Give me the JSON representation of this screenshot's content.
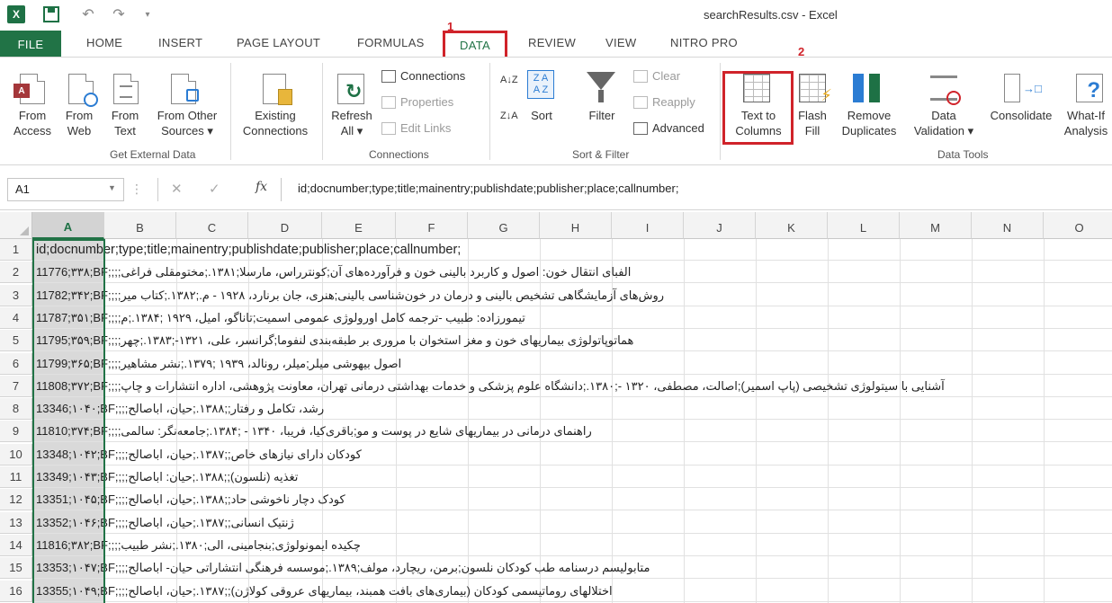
{
  "window": {
    "title": "searchResults.csv - Excel",
    "app_badge": "X"
  },
  "tabs": [
    "FILE",
    "HOME",
    "INSERT",
    "PAGE LAYOUT",
    "FORMULAS",
    "DATA",
    "REVIEW",
    "VIEW",
    "NITRO PRO"
  ],
  "annotations": {
    "step1": "1",
    "step2": "2"
  },
  "ribbon": {
    "get_external": {
      "label": "Get External Data",
      "buttons": [
        {
          "line1": "From",
          "line2": "Access"
        },
        {
          "line1": "From",
          "line2": "Web"
        },
        {
          "line1": "From",
          "line2": "Text"
        },
        {
          "line1": "From Other",
          "line2": "Sources ▾"
        }
      ]
    },
    "existing": {
      "line1": "Existing",
      "line2": "Connections"
    },
    "connections": {
      "label": "Connections",
      "refresh_line1": "Refresh",
      "refresh_line2": "All ▾",
      "items": [
        "Connections",
        "Properties",
        "Edit Links"
      ]
    },
    "sort_filter": {
      "label": "Sort & Filter",
      "az_icon": "A↓Z",
      "za_icon": "Z↓A",
      "sort_big_top": "Z A",
      "sort_big_bottom": "A Z",
      "sort": "Sort",
      "filter": "Filter",
      "clear": "Clear",
      "reapply": "Reapply",
      "advanced": "Advanced"
    },
    "data_tools": {
      "label": "Data Tools",
      "text_to_columns": {
        "line1": "Text to",
        "line2": "Columns"
      },
      "flash_fill": {
        "line1": "Flash",
        "line2": "Fill"
      },
      "remove_duplicates": {
        "line1": "Remove",
        "line2": "Duplicates"
      },
      "data_validation": {
        "line1": "Data",
        "line2": "Validation ▾"
      },
      "consolidate": "Consolidate",
      "what_if": {
        "line1": "What-If",
        "line2": "Analysis"
      }
    }
  },
  "formula_bar": {
    "name_box": "A1",
    "fx": "fx",
    "cancel": "✕",
    "enter": "✓",
    "dots": "⋮",
    "value": "id;docnumber;type;title;mainentry;publishdate;publisher;place;callnumber;"
  },
  "grid": {
    "columns": [
      "A",
      "B",
      "C",
      "D",
      "E",
      "F",
      "G",
      "H",
      "I",
      "J",
      "K",
      "L",
      "M",
      "N",
      "O"
    ],
    "rows": [
      {
        "n": "1",
        "prefix": "id;docnumber;type;title;mainentry;publishdate;publisher;place;callnumber;",
        "rtl": ""
      },
      {
        "n": "2",
        "prefix": "11776;۳۳۸;BF;",
        "rtl": "الفبای انتقال خون: اصول و کاربرد بالینی خون و فرآورده‌های آن;کونترراس، مارسلا;۱۳۸۱.;مختومقلی فراغی;;;"
      },
      {
        "n": "3",
        "prefix": "11782;۳۴۲;BF;",
        "rtl": "روش‌های آزمایشگاهی تشخیص بالینی و درمان در خون‌شناسی بالینی;هنری، جان برنارد، ۱۹۲۸ - م.;۱۳۸۲.;کتاب میر;;;"
      },
      {
        "n": "4",
        "prefix": "11787;۳۵۱;BF;",
        "rtl": "تیمورزاده: طبیب -ترجمه کامل اورولوژی عمومی اسمیت;تاناگو، امیل، ۱۹۲۹ ;۱۳۸۴.;م;;;"
      },
      {
        "n": "5",
        "prefix": "11795;۳۵۹;BF;",
        "rtl": "هماتوپاتولوژی بیماریهای خون و مغز استخوان با مروری بر طبقه‌بندی لنفوما;گرانسر، علی، ۱۳۲۱-;۱۳۸۳.;چهر;;;"
      },
      {
        "n": "6",
        "prefix": "11799;۳۶۵;BF;",
        "rtl": "اصول بیهوشی میلر;میلر، رونالد، ۱۹۳۹ ;۱۳۷۹.;نشر مشاهیر;;;"
      },
      {
        "n": "7",
        "prefix": "11808;۳۷۲;BF;",
        "rtl": "آشنایی با سیتولوژی تشخیصی (پاپ اسمیر);اصالت، مصطفی، ۱۳۲۰ -;۱۳۸۰.;دانشگاه علوم پزشکی و خدمات بهداشتی درمانی تهران، معاونت پژوهشی، اداره انتشارات و چاپ;;;"
      },
      {
        "n": "8",
        "prefix": "13346;۱۰۴۰;BF;",
        "rtl": "رشد، تکامل و رفتار;;۱۳۸۸.;حیان، اباصالح;;;"
      },
      {
        "n": "9",
        "prefix": "11810;۳۷۴;BF;",
        "rtl": "راهنمای درمانی در بیماریهای شایع در پوست و مو;باقری‌کیا، فریبا، ۱۳۴۰ - ;۱۳۸۴.;جامعه‌نگر: سالمی;;;"
      },
      {
        "n": "10",
        "prefix": "13348;۱۰۴۲;BF;",
        "rtl": "کودکان دارای نیازهای خاص;;۱۳۸۷.;حیان، اباصالح;;;"
      },
      {
        "n": "11",
        "prefix": "13349;۱۰۴۳;BF;",
        "rtl": "تغذیه (نلسون);;۱۳۸۸.;حیان: اباصالح;;;"
      },
      {
        "n": "12",
        "prefix": "13351;۱۰۴۵;BF;",
        "rtl": "کودک دچار ناخوشی حاد;;۱۳۸۸.;حیان، اباصالح;;;"
      },
      {
        "n": "13",
        "prefix": "13352;۱۰۴۶;BF;",
        "rtl": "ژنتیک انسانی;;۱۳۸۷.;حیان، اباصالح;;;"
      },
      {
        "n": "14",
        "prefix": "11816;۳۸۲;BF;",
        "rtl": "چکیده ایمونولوژی;بنجامینی، الی;۱۳۸۰.;نشر طبیب;;;"
      },
      {
        "n": "15",
        "prefix": "13353;۱۰۴۷;BF;",
        "rtl": "متابولیسم درسنامه طب کودکان نلسون;برمن، ریچارد، مولف;۱۳۸۹.;موسسه فرهنگی انتشاراتی حیان- اباصالح;;;"
      },
      {
        "n": "16",
        "prefix": "13355;۱۰۴۹;BF;",
        "rtl": "اختلالهای روماتیسمی کودکان (بیماری‌های بافت همبند، بیماریهای عروقی کولاژن);;۱۳۸۷.;حیان، اباصالح;;;"
      }
    ]
  }
}
